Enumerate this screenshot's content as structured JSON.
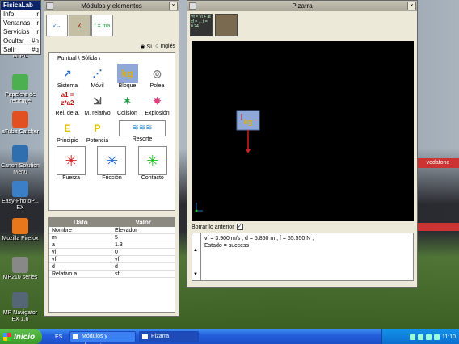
{
  "app": {
    "menu_title": "FisicaLab"
  },
  "app_menu": [
    {
      "label": "Info",
      "shortcut": "r"
    },
    {
      "label": "Ventanas",
      "shortcut": "r"
    },
    {
      "label": "Servicios",
      "shortcut": "r"
    },
    {
      "label": "Ocultar",
      "shortcut": "#h"
    },
    {
      "label": "Salir",
      "shortcut": "#q"
    }
  ],
  "desktop": {
    "icons": [
      {
        "label": "Mi PC",
        "icon": "computer-icon",
        "color": "#6a8fc0"
      },
      {
        "label": "Papelera de reciclaje",
        "icon": "recycle-bin-icon",
        "color": "#4caf50"
      },
      {
        "label": "aTube Catcher",
        "icon": "atube-catcher-icon",
        "color": "#e05020"
      },
      {
        "label": "Canon Solution Menu",
        "icon": "canon-icon",
        "color": "#2f6fb0"
      },
      {
        "label": "Easy-PhotoP... EX",
        "icon": "easy-photoprint-icon",
        "color": "#3a7fc8"
      },
      {
        "label": "Mozilla Firefox",
        "icon": "firefox-icon",
        "color": "#e8761b"
      },
      {
        "label": "MP210 series",
        "icon": "printer-icon",
        "color": "#888888"
      },
      {
        "label": "MP Navigator EX 1.0",
        "icon": "mp-navigator-icon",
        "color": "#556677"
      }
    ],
    "banner": "vodafone"
  },
  "modules_window": {
    "title": "Módulos y elementos",
    "tools": [
      "kinematics-tool-icon",
      "statics-tool-icon",
      "dynamics-tool-icon"
    ],
    "language": {
      "option1": "Sí",
      "option2": "Inglés"
    },
    "tabs": "Puntual \\ Sólida \\",
    "elements": [
      {
        "label": "Sistema",
        "icon": "system-axes-icon",
        "glyph": "↗",
        "color": "#2a6fd0"
      },
      {
        "label": "Móvil",
        "icon": "mobile-icon",
        "glyph": "⋰",
        "color": "#1f5fc0"
      },
      {
        "label": "Bloque",
        "icon": "block-icon",
        "glyph": "kg",
        "color": "#e0b000"
      },
      {
        "label": "Polea",
        "icon": "pulley-icon",
        "glyph": "◎",
        "color": "#777777"
      },
      {
        "label": "Rel. de a.",
        "icon": "acceleration-relation-icon",
        "glyph": "a1 = z*a2",
        "color": "#c01010"
      },
      {
        "label": "M. relativo",
        "icon": "relative-motion-icon",
        "glyph": "⇲",
        "color": "#444444"
      },
      {
        "label": "Colisión",
        "icon": "collision-icon",
        "glyph": "✶",
        "color": "#20a040"
      },
      {
        "label": "Explosión",
        "icon": "explosion-icon",
        "glyph": "✸",
        "color": "#e04080"
      },
      {
        "label": "Principio",
        "icon": "principle-icon",
        "glyph": "E",
        "color": "#e0c000"
      },
      {
        "label": "Potencia",
        "icon": "power-icon",
        "glyph": "P",
        "color": "#e0c000"
      }
    ],
    "resorte": {
      "label": "Resorte",
      "icon": "spring-icon"
    },
    "forces": [
      {
        "label": "Fuerza",
        "icon": "force-icon",
        "color": "#d02020"
      },
      {
        "label": "Fricción",
        "icon": "friction-icon",
        "color": "#2060d0"
      },
      {
        "label": "Contacto",
        "icon": "contact-icon",
        "color": "#20c020"
      }
    ]
  },
  "data_table": {
    "headers": [
      "Dato",
      "Valor"
    ],
    "rows": [
      [
        "Nombre",
        "Elevador"
      ],
      [
        "m",
        "5"
      ],
      [
        "a",
        "1.3"
      ],
      [
        "vi",
        "0"
      ],
      [
        "vf",
        "vf"
      ],
      [
        "d",
        "d"
      ],
      [
        "Relativo a",
        "sf"
      ]
    ]
  },
  "pizarra": {
    "title": "Pizarra",
    "tools": [
      {
        "icon": "solve-tool-icon",
        "text": "Vf = Vi + at  xf = ...  t = 0.24"
      },
      {
        "icon": "clear-tool-icon",
        "text": ""
      }
    ],
    "block_label": "kg",
    "undo_label": "Borrar lo anterior",
    "undo_checked": true,
    "output_line1": "vf = 3.900 m/s ;  d = 5.850 m ;  f = 55.550 N ;",
    "output_line2": "Estado = success"
  },
  "taskbar": {
    "start": "Inicio",
    "language": "ES",
    "tasks": [
      "Módulos y elementos",
      "Pizarra"
    ],
    "clock": "11:10"
  }
}
